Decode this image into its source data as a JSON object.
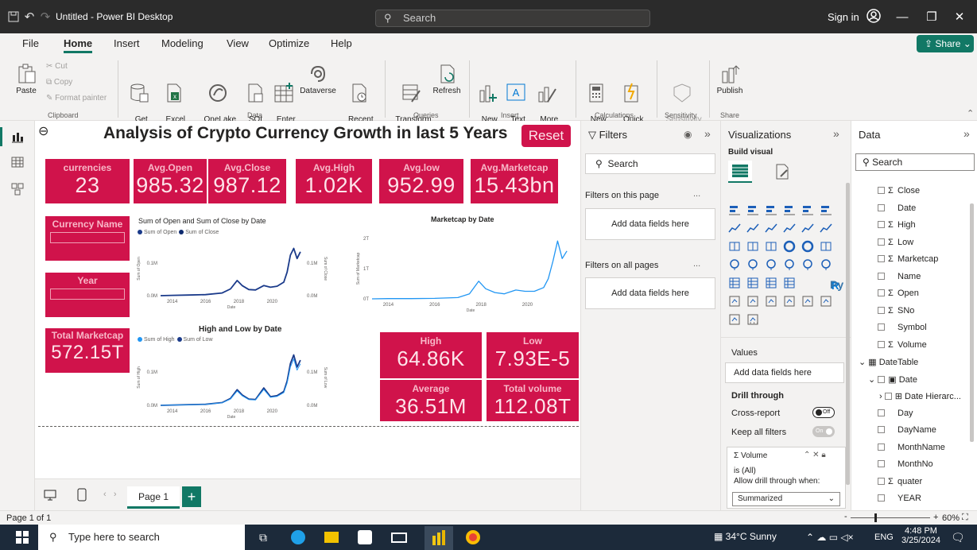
{
  "window": {
    "title": "Untitled - Power BI Desktop",
    "search_placeholder": "Search",
    "sign_in": "Sign in"
  },
  "menu": {
    "tabs": [
      "File",
      "Home",
      "Insert",
      "Modeling",
      "View",
      "Optimize",
      "Help"
    ],
    "active": "Home",
    "share": "Share"
  },
  "ribbon": {
    "paste": "Paste",
    "cut": "Cut",
    "copy": "Copy",
    "format_painter": "Format painter",
    "get_data": "Get\ndata ⌄",
    "excel": "Excel\nworkbook",
    "onelake": "OneLake\ndata hub ⌄",
    "sql": "SQL\nServer",
    "enter_data": "Enter\ndata",
    "dataverse": "Dataverse",
    "recent": "Recent\nsources ⌄",
    "transform": "Transform\ndata ⌄",
    "refresh": "Refresh",
    "new_visual": "New\nvisual",
    "text_box": "Text\nbox",
    "more_visuals": "More\nvisuals ⌄",
    "new_measure": "New\nmeasure",
    "quick_measure": "Quick\nmeasure",
    "sensitivity": "Sensitivity\n⌄",
    "publish": "Publish",
    "groups": {
      "clipboard": "Clipboard",
      "data": "Data",
      "queries": "Queries",
      "insert": "Insert",
      "calculations": "Calculations",
      "sensitivity": "Sensitivity",
      "share": "Share"
    }
  },
  "report": {
    "title": "Analysis of Crypto Currency Growth in last 5 Years",
    "reset": "Reset",
    "cards": [
      {
        "label": "currencies",
        "value": "23"
      },
      {
        "label": "Avg.Open",
        "value": "985.32"
      },
      {
        "label": "Avg.Close",
        "value": "987.12"
      },
      {
        "label": "Avg.High",
        "value": "1.02K"
      },
      {
        "label": "Avg.low",
        "value": "952.99"
      },
      {
        "label": "Avg.Marketcap",
        "value": "15.43bn"
      }
    ],
    "slicers": {
      "currency": "Currency Name",
      "year": "Year"
    },
    "total_marketcap": {
      "label": "Total Marketcap",
      "value": "572.15T"
    },
    "bottom_cards": [
      {
        "label": "High",
        "value": "64.86K"
      },
      {
        "label": "Low",
        "value": "7.93E-5"
      },
      {
        "label": "Average",
        "value": "36.51M"
      },
      {
        "label": "Total volume",
        "value": "112.08T"
      }
    ],
    "page_tab": "Page 1"
  },
  "chart_data": [
    {
      "type": "line",
      "title": "Sum of Open and Sum of Close by Date",
      "xlabel": "Date",
      "ylabel": "Sum of Open",
      "ylabel2": "Sum of Close",
      "series": [
        {
          "name": "Sum of Open"
        },
        {
          "name": "Sum of Close"
        }
      ],
      "x_ticks": [
        "2014",
        "2016",
        "2018",
        "2020"
      ],
      "y_ticks": [
        "0.0M",
        "0.1M"
      ],
      "y2_ticks": [
        "0.0M",
        "0.1M"
      ],
      "x": [
        2013.3,
        2014,
        2015,
        2016,
        2017,
        2017.5,
        2017.9,
        2018.2,
        2018.6,
        2019,
        2019.5,
        2019.9,
        2020.3,
        2020.7,
        2020.9,
        2021.1,
        2021.3,
        2021.5,
        2021.7
      ],
      "y": [
        0.0,
        0.001,
        0.002,
        0.003,
        0.008,
        0.02,
        0.045,
        0.03,
        0.018,
        0.017,
        0.03,
        0.025,
        0.028,
        0.04,
        0.07,
        0.12,
        0.14,
        0.11,
        0.13
      ]
    },
    {
      "type": "line",
      "title": "Marketcap by Date",
      "xlabel": "Date",
      "ylabel": "Sum of Marketcap",
      "x_ticks": [
        "2014",
        "2016",
        "2018",
        "2020"
      ],
      "y_ticks": [
        "0T",
        "1T",
        "2T"
      ],
      "x": [
        2013.3,
        2014,
        2015,
        2016,
        2017,
        2017.5,
        2017.9,
        2018.2,
        2018.6,
        2019,
        2019.5,
        2019.9,
        2020.3,
        2020.7,
        2020.9,
        2021.1,
        2021.3,
        2021.5,
        2021.7
      ],
      "y": [
        0.0,
        0.01,
        0.01,
        0.02,
        0.05,
        0.2,
        0.7,
        0.4,
        0.25,
        0.2,
        0.35,
        0.3,
        0.3,
        0.45,
        0.8,
        1.5,
        2.3,
        1.6,
        1.9
      ]
    },
    {
      "type": "line",
      "title": "High and Low by Date",
      "xlabel": "Date",
      "ylabel": "Sum of High",
      "ylabel2": "Sum of Low",
      "series": [
        {
          "name": "Sum of High"
        },
        {
          "name": "Sum of Low"
        }
      ],
      "x_ticks": [
        "2014",
        "2016",
        "2018",
        "2020"
      ],
      "y_ticks": [
        "0.0M",
        "0.1M"
      ],
      "y2_ticks": [
        "0.0M",
        "0.1M"
      ],
      "x": [
        2013.3,
        2014,
        2015,
        2016,
        2017,
        2017.5,
        2017.9,
        2018.2,
        2018.6,
        2019,
        2019.5,
        2019.9,
        2020.3,
        2020.7,
        2020.9,
        2021.1,
        2021.3,
        2021.5,
        2021.7
      ],
      "y": [
        0.0,
        0.001,
        0.002,
        0.003,
        0.008,
        0.02,
        0.045,
        0.03,
        0.018,
        0.017,
        0.05,
        0.025,
        0.028,
        0.04,
        0.07,
        0.12,
        0.145,
        0.11,
        0.13
      ]
    }
  ],
  "filters": {
    "title": "Filters",
    "search": "Search",
    "on_page": "Filters on this page",
    "on_all": "Filters on all pages",
    "add": "Add data fields here",
    "more": "..."
  },
  "visualizations": {
    "title": "Visualizations",
    "build": "Build visual",
    "values": "Values",
    "add": "Add data fields here",
    "drill": "Drill through",
    "cross": "Cross-report",
    "cross_state": "Off",
    "keep": "Keep all filters",
    "keep_state": "On",
    "volume_field": "Σ Volume",
    "is_all": "is (All)",
    "allow": "Allow drill through when:",
    "summarized": "Summarized",
    "r": "R",
    "py": "Py",
    "ellipsis": "···"
  },
  "data": {
    "title": "Data",
    "search": "Search",
    "rows": [
      {
        "t": "Σ",
        "name": "Close",
        "indent": 1
      },
      {
        "t": "",
        "name": "Date",
        "indent": 1
      },
      {
        "t": "Σ",
        "name": "High",
        "indent": 1
      },
      {
        "t": "Σ",
        "name": "Low",
        "indent": 1
      },
      {
        "t": "Σ",
        "name": "Marketcap",
        "indent": 1
      },
      {
        "t": "",
        "name": "Name",
        "indent": 1
      },
      {
        "t": "Σ",
        "name": "Open",
        "indent": 1
      },
      {
        "t": "Σ",
        "name": "SNo",
        "indent": 1
      },
      {
        "t": "",
        "name": "Symbol",
        "indent": 1
      },
      {
        "t": "Σ",
        "name": "Volume",
        "indent": 1
      }
    ],
    "table": "DateTable",
    "date": "Date",
    "hier": "Date Hierarc...",
    "rows2": [
      {
        "t": "",
        "name": "Day"
      },
      {
        "t": "",
        "name": "DayName"
      },
      {
        "t": "",
        "name": "MonthName"
      },
      {
        "t": "",
        "name": "MonthNo"
      },
      {
        "t": "Σ",
        "name": "quater"
      },
      {
        "t": "",
        "name": "YEAR"
      }
    ]
  },
  "status": {
    "page": "Page 1 of 1",
    "zoom": "60%"
  },
  "taskbar": {
    "search": "Type here to search",
    "weather": "34°C  Sunny",
    "lang": "ENG",
    "time": "4:48 PM",
    "date": "3/25/2024"
  },
  "colors": {
    "accent": "#117865",
    "card": "#d0134b",
    "line1": "#1a3a8a",
    "line2": "#2196f3"
  }
}
